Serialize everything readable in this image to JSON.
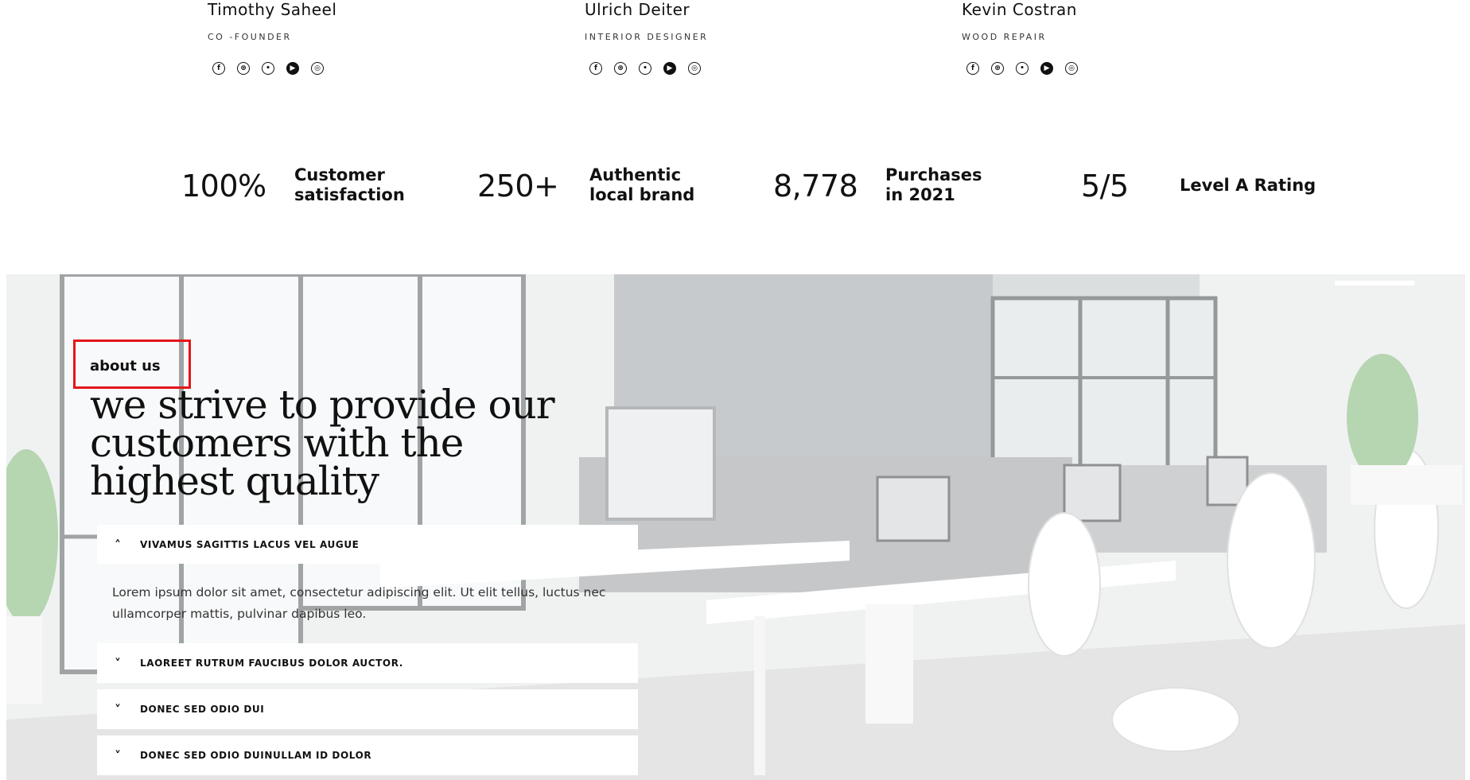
{
  "team": [
    {
      "name": "Timothy Saheel",
      "role": "CO -FOUNDER"
    },
    {
      "name": "Ulrich Deiter",
      "role": "INTERIOR DESIGNER"
    },
    {
      "name": "Kevin Costran",
      "role": "WOOD REPAIR"
    }
  ],
  "social_icons": [
    "facebook-icon",
    "dribbble-icon",
    "twitter-icon",
    "youtube-icon",
    "instagram-icon"
  ],
  "social_glyphs": [
    "f",
    "⊕",
    "•",
    "▶",
    "◎"
  ],
  "stats": [
    {
      "number": "100%",
      "label": "Customer satisfaction"
    },
    {
      "number": "250+",
      "label": "Authentic local brand"
    },
    {
      "number": "8,778",
      "label": "Purchases in 2021"
    },
    {
      "number": "5/5",
      "label": "Level A Rating"
    }
  ],
  "about": {
    "kicker": "about us",
    "heading": "we strive to provide our customers with the highest quality",
    "highlight_color": "#e3161b",
    "accordion": [
      {
        "title": "VIVAMUS SAGITTIS LACUS VEL AUGUE",
        "expanded": true,
        "body": "Lorem ipsum dolor sit amet, consectetur adipiscing elit. Ut elit tellus, luctus nec ullamcorper mattis, pulvinar dapibus leo."
      },
      {
        "title": "LAOREET RUTRUM FAUCIBUS DOLOR AUCTOR.",
        "expanded": false
      },
      {
        "title": "DONEC SED ODIO DUI",
        "expanded": false
      },
      {
        "title": "DONEC SED ODIO DUINULLAM ID DOLOR",
        "expanded": false
      }
    ],
    "chevron_up": "˄",
    "chevron_down": "˅"
  }
}
